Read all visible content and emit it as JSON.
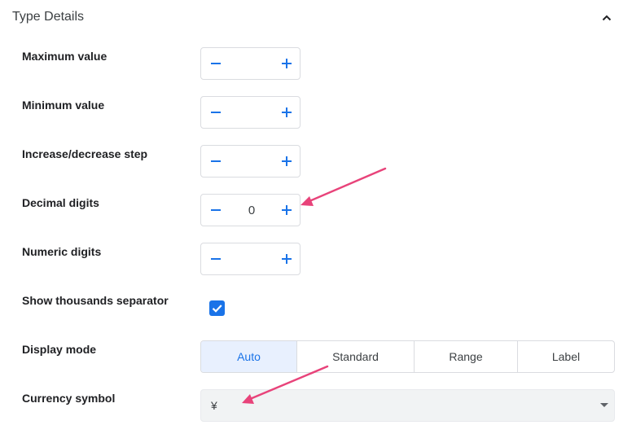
{
  "section": {
    "title": "Type Details",
    "toggle_icon": "chevron-up-icon"
  },
  "fields": {
    "maximum_value": {
      "label": "Maximum value",
      "value": ""
    },
    "minimum_value": {
      "label": "Minimum value",
      "value": ""
    },
    "step": {
      "label": "Increase/decrease step",
      "value": ""
    },
    "decimal_digits": {
      "label": "Decimal digits",
      "value": "0"
    },
    "numeric_digits": {
      "label": "Numeric digits",
      "value": ""
    }
  },
  "stepper_icons": {
    "minus": "minus-icon",
    "plus": "plus-icon"
  },
  "thousands_separator": {
    "label": "Show thousands separator",
    "checked": true
  },
  "display_mode": {
    "label": "Display mode",
    "options": [
      "Auto",
      "Standard",
      "Range",
      "Label"
    ],
    "selected": "Auto"
  },
  "currency": {
    "label": "Currency symbol",
    "value": "¥"
  },
  "colors": {
    "accent": "#1a73e8",
    "annotation_arrow": "#e8437a",
    "selected_bg": "#e8f0fe"
  }
}
